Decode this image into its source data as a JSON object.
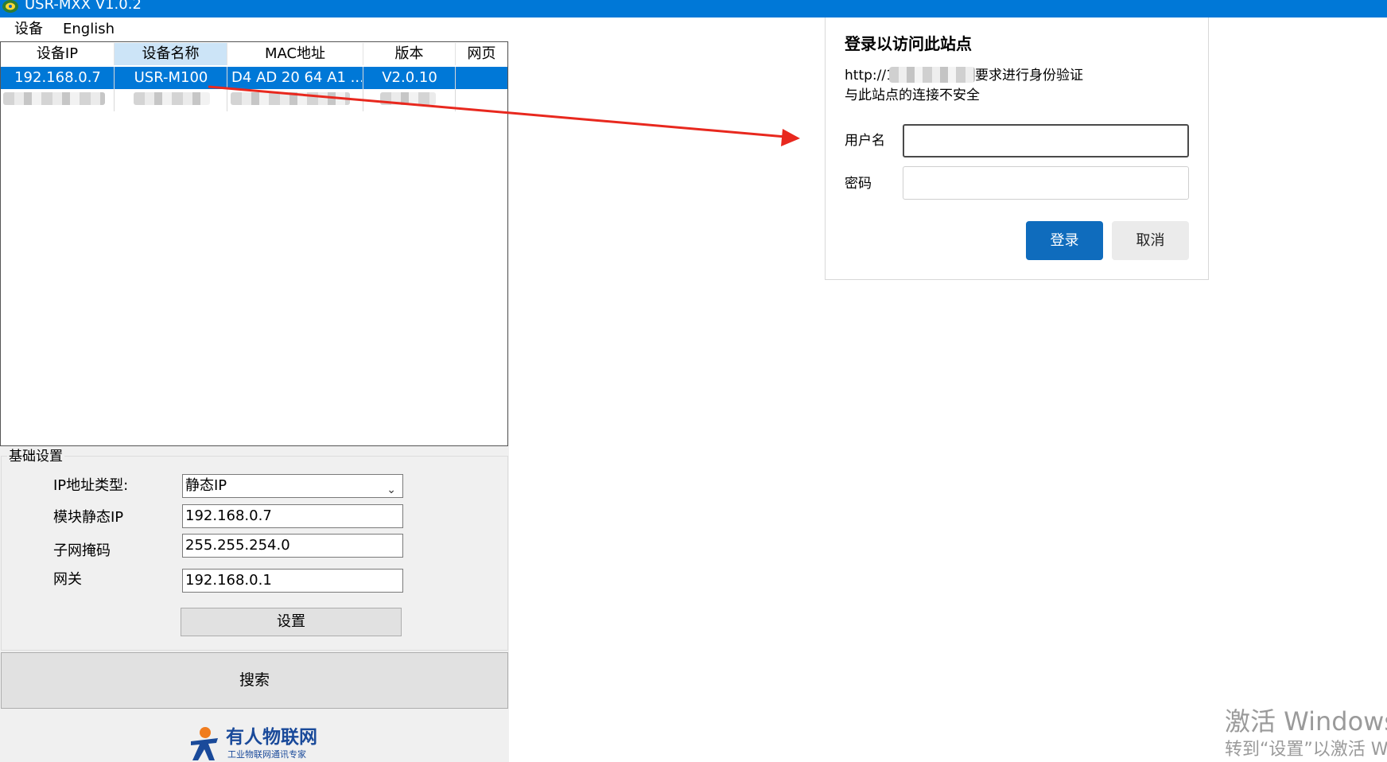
{
  "window": {
    "title": "USR-MXX  V1.0.2"
  },
  "menu": {
    "items": [
      "设备",
      "English"
    ]
  },
  "device_table": {
    "columns": [
      "设备IP",
      "设备名称",
      "MAC地址",
      "版本",
      "网页"
    ],
    "rows": [
      {
        "ip": "192.168.0.7",
        "name": "USR-M100",
        "mac": "D4 AD 20 64 A1 ...",
        "version": "V2.0.10",
        "web": ""
      }
    ]
  },
  "basic_settings": {
    "title": "基础设置",
    "ip_type_label": "IP地址类型:",
    "ip_type_value": "静态IP",
    "static_ip_label": "模块静态IP",
    "static_ip_value": "192.168.0.7",
    "subnet_label": "子网掩码",
    "subnet_value": "255.255.254.0",
    "gateway_label": "网关",
    "gateway_value": "192.168.0.1",
    "set_button": "设置"
  },
  "search_button": "搜索",
  "logo": {
    "name": "有人物联网",
    "tagline": "工业物联网通讯专家"
  },
  "login_dialog": {
    "title": "登录以访问此站点",
    "url_prefix": "http://1",
    "auth_text": "要求进行身份验证",
    "warning": "与此站点的连接不安全",
    "username_label": "用户名",
    "password_label": "密码",
    "login_button": "登录",
    "cancel_button": "取消"
  },
  "watermark": {
    "line1": "激活 Windows",
    "line2": "转到“设置”以激活 Wi"
  },
  "colors": {
    "titlebar": "#0078d7",
    "selection": "#0078d7",
    "login_button": "#0f6cbd",
    "arrow": "#e8281e"
  }
}
